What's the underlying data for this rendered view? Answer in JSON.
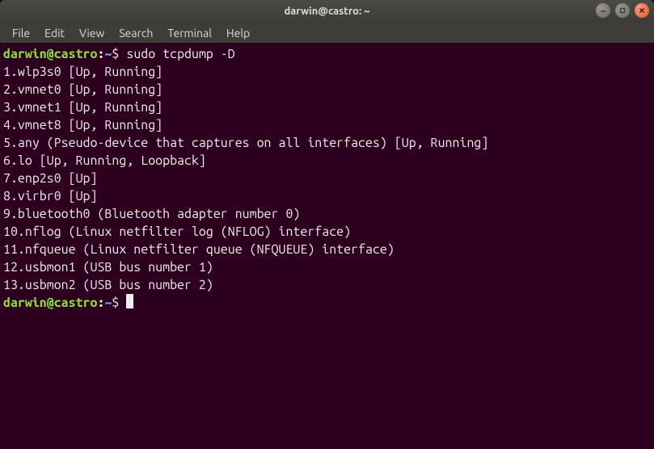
{
  "window": {
    "title": "darwin@castro: ~"
  },
  "menu": {
    "items": [
      "File",
      "Edit",
      "View",
      "Search",
      "Terminal",
      "Help"
    ]
  },
  "prompt": {
    "userhost": "darwin@castro",
    "colon": ":",
    "path": "~",
    "dollar": "$"
  },
  "command": "sudo tcpdump -D",
  "output": [
    "1.wlp3s0 [Up, Running]",
    "2.vmnet0 [Up, Running]",
    "3.vmnet1 [Up, Running]",
    "4.vmnet8 [Up, Running]",
    "5.any (Pseudo-device that captures on all interfaces) [Up, Running]",
    "6.lo [Up, Running, Loopback]",
    "7.enp2s0 [Up]",
    "8.virbr0 [Up]",
    "9.bluetooth0 (Bluetooth adapter number 0)",
    "10.nflog (Linux netfilter log (NFLOG) interface)",
    "11.nfqueue (Linux netfilter queue (NFQUEUE) interface)",
    "12.usbmon1 (USB bus number 1)",
    "13.usbmon2 (USB bus number 2)"
  ]
}
